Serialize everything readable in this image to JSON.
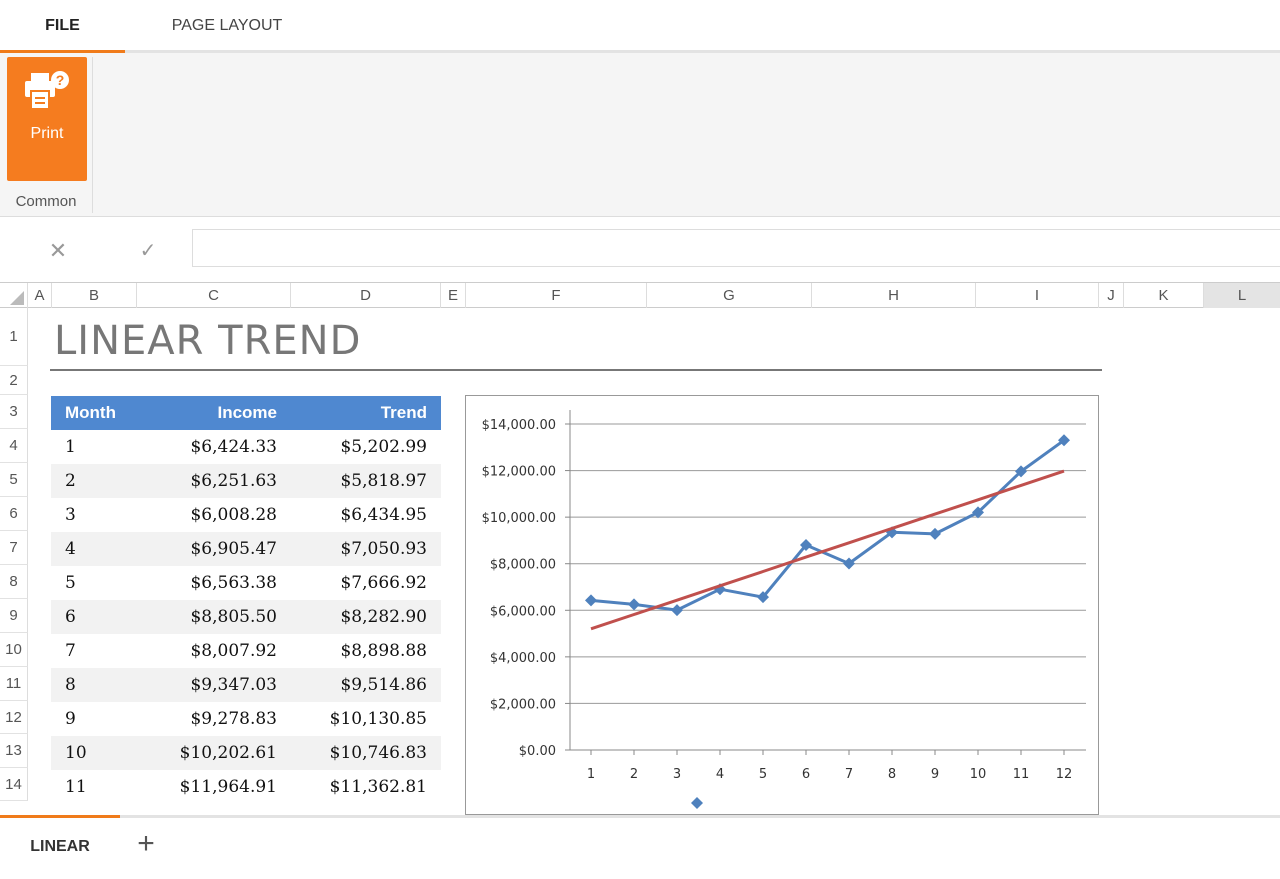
{
  "ribbon": {
    "tabs": [
      {
        "label": "FILE",
        "active": true
      },
      {
        "label": "PAGE LAYOUT",
        "active": false
      }
    ],
    "print_label": "Print",
    "group_label": "Common",
    "accent_color": "#f57c1f"
  },
  "formula_bar": {
    "cancel_icon": "close-icon",
    "confirm_icon": "check-icon",
    "value": ""
  },
  "columns": [
    "A",
    "B",
    "C",
    "D",
    "E",
    "F",
    "G",
    "H",
    "I",
    "J",
    "K",
    "L"
  ],
  "selected_column": "L",
  "rows": [
    "1",
    "2",
    "3",
    "4",
    "5",
    "6",
    "7",
    "8",
    "9",
    "10",
    "11",
    "12",
    "13",
    "14"
  ],
  "sheet": {
    "title": "LINEAR TREND",
    "table": {
      "headers": [
        "Month",
        "Income",
        "Trend"
      ],
      "rows": [
        [
          "1",
          "$6,424.33",
          "$5,202.99"
        ],
        [
          "2",
          "$6,251.63",
          "$5,818.97"
        ],
        [
          "3",
          "$6,008.28",
          "$6,434.95"
        ],
        [
          "4",
          "$6,905.47",
          "$7,050.93"
        ],
        [
          "5",
          "$6,563.38",
          "$7,666.92"
        ],
        [
          "6",
          "$8,805.50",
          "$8,282.90"
        ],
        [
          "7",
          "$8,007.92",
          "$8,898.88"
        ],
        [
          "8",
          "$9,347.03",
          "$9,514.86"
        ],
        [
          "9",
          "$9,278.83",
          "$10,130.85"
        ],
        [
          "10",
          "$10,202.61",
          "$10,746.83"
        ],
        [
          "11",
          "$11,964.91",
          "$11,362.81"
        ]
      ]
    }
  },
  "chart_data": {
    "type": "line",
    "x": [
      1,
      2,
      3,
      4,
      5,
      6,
      7,
      8,
      9,
      10,
      11,
      12
    ],
    "series": [
      {
        "values": [
          6424.33,
          6251.63,
          6008.28,
          6905.47,
          6563.38,
          8805.5,
          8007.92,
          9347.03,
          9278.83,
          10202.61,
          11964.91,
          13300
        ],
        "color": "#4f81bd",
        "marker": "diamond"
      },
      {
        "values": [
          5202.99,
          5818.97,
          6434.95,
          7050.93,
          7666.92,
          8282.9,
          8898.88,
          9514.86,
          10130.85,
          10746.83,
          11362.81,
          11978.8
        ],
        "color": "#c0504d",
        "marker": "none"
      }
    ],
    "y_ticks": [
      "$0.00",
      "$2,000.00",
      "$4,000.00",
      "$6,000.00",
      "$8,000.00",
      "$10,000.00",
      "$12,000.00",
      "$14,000.00"
    ],
    "x_ticks": [
      "1",
      "2",
      "3",
      "4",
      "5",
      "6",
      "7",
      "8",
      "9",
      "10",
      "11",
      "12"
    ],
    "ylim": [
      0,
      14000
    ],
    "grid": true,
    "legend": "bottom"
  },
  "bottom": {
    "sheet_tab": "LINEAR",
    "add_icon": "plus-icon"
  }
}
